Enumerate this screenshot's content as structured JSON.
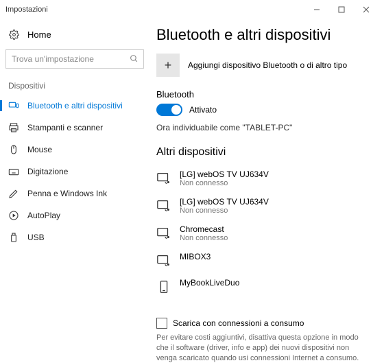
{
  "window": {
    "title": "Impostazioni"
  },
  "sidebar": {
    "home": "Home",
    "search_placeholder": "Trova un'impostazione",
    "group": "Dispositivi",
    "items": [
      {
        "label": "Bluetooth e altri dispositivi"
      },
      {
        "label": "Stampanti e scanner"
      },
      {
        "label": "Mouse"
      },
      {
        "label": "Digitazione"
      },
      {
        "label": "Penna e Windows Ink"
      },
      {
        "label": "AutoPlay"
      },
      {
        "label": "USB"
      }
    ]
  },
  "main": {
    "title": "Bluetooth e altri dispositivi",
    "add_label": "Aggiungi dispositivo Bluetooth o di altro tipo",
    "bt_label": "Bluetooth",
    "toggle_state": "Attivato",
    "discoverable": "Ora individuabile come \"TABLET-PC\"",
    "other_heading": "Altri dispositivi",
    "devices": [
      {
        "name": "[LG] webOS TV UJ634V",
        "status": "Non connesso"
      },
      {
        "name": "[LG] webOS TV UJ634V",
        "status": "Non connesso"
      },
      {
        "name": "Chromecast",
        "status": "Non connesso"
      },
      {
        "name": "MIBOX3",
        "status": ""
      },
      {
        "name": "MyBookLiveDuo",
        "status": ""
      }
    ],
    "metered_label": "Scarica con connessioni a consumo",
    "metered_desc": "Per evitare costi aggiuntivi, disattiva questa opzione in modo che il software (driver, info e app) dei nuovi dispositivi non venga scaricato quando usi connessioni Internet a consumo."
  }
}
